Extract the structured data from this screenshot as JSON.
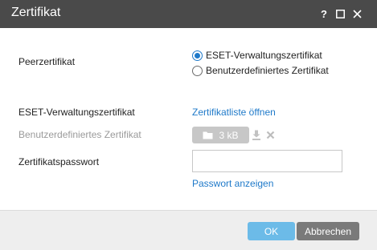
{
  "window": {
    "title": "Zertifikat",
    "help_label": "?"
  },
  "form": {
    "peer_label": "Peerzertifikat",
    "radio_eset_label": "ESET-Verwaltungszertifikat",
    "radio_custom_label": "Benutzerdefiniertes Zertifikat",
    "radio_selected": "ESET-Verwaltungszertifikat",
    "eset_cert_label": "ESET-Verwaltungszertifikat",
    "open_list_link": "Zertifikatliste öffnen",
    "custom_cert_label": "Benutzerdefiniertes Zertifikat",
    "file_size": "3 kB",
    "password_label": "Zertifikatspasswort",
    "password_value": "",
    "show_password_link": "Passwort anzeigen"
  },
  "footer": {
    "ok_label": "OK",
    "cancel_label": "Abbrechen"
  },
  "colors": {
    "titlebar": "#4a4a4a",
    "link": "#1e79c9",
    "ok_button": "#6cbbe8",
    "cancel_button": "#7a7a7a",
    "footer_bg": "#eeeeee",
    "disabled_text": "#9a9a9a"
  },
  "icons": {
    "help": "help-icon",
    "maximize": "maximize-icon",
    "close": "close-icon",
    "folder": "folder-icon",
    "download": "download-icon",
    "remove": "remove-icon"
  }
}
